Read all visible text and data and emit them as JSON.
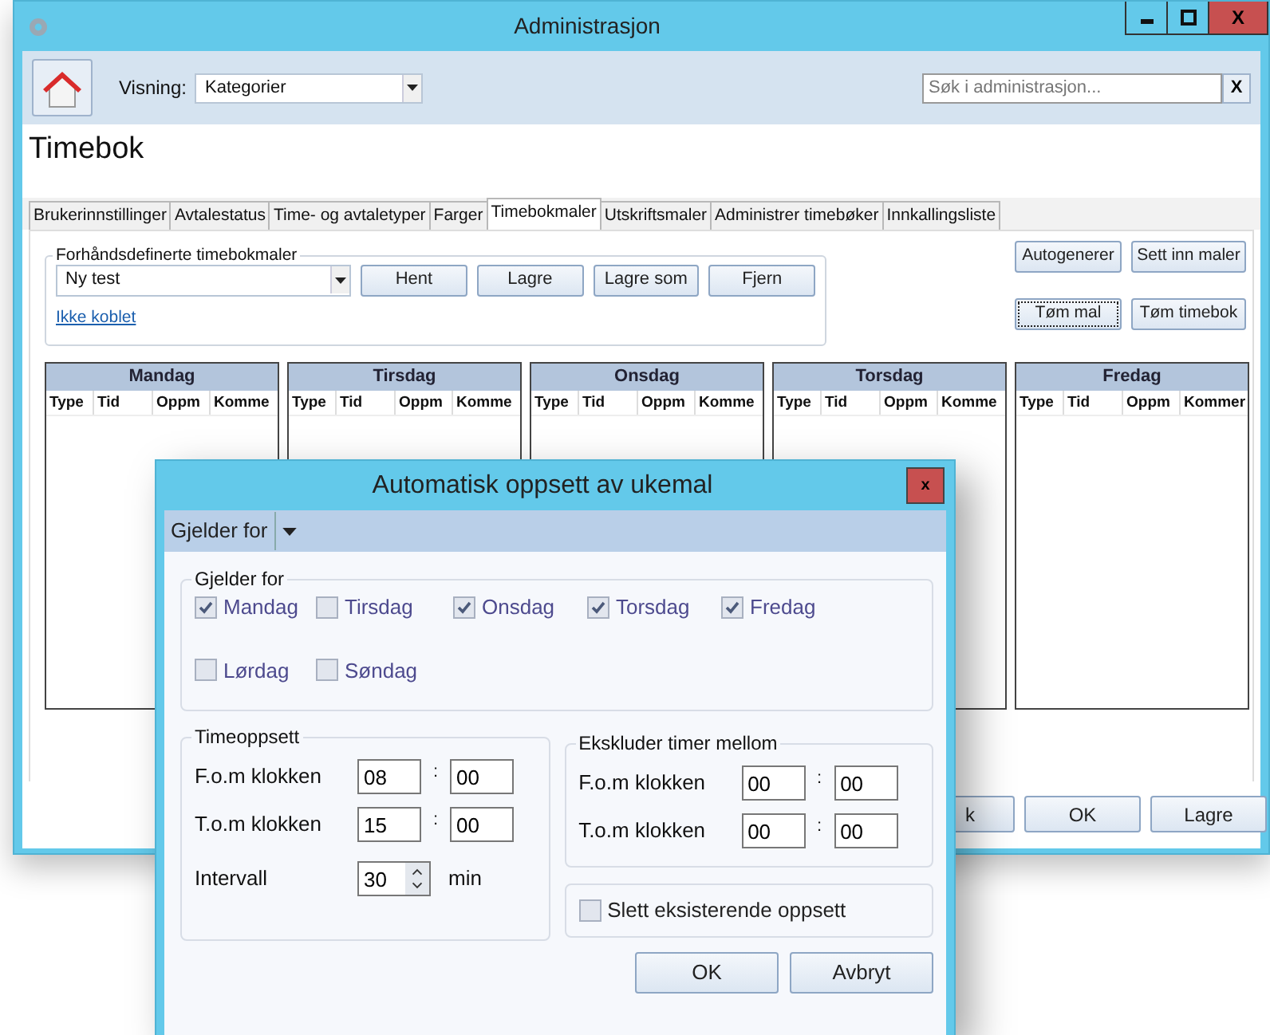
{
  "main_window": {
    "title": "Administrasjon",
    "close_glyph": "X",
    "toolbar": {
      "view_label": "Visning:",
      "view_value": "Kategorier",
      "search_placeholder": "Søk i administrasjon...",
      "search_clear": "X"
    },
    "heading": "Timebok",
    "tabs": [
      {
        "label": "Brukerinnstillinger",
        "selected": false
      },
      {
        "label": "Avtalestatus",
        "selected": false
      },
      {
        "label": "Time- og avtaletyper",
        "selected": false
      },
      {
        "label": "Farger",
        "selected": false
      },
      {
        "label": "Timebokmaler",
        "selected": true
      },
      {
        "label": "Utskriftsmaler",
        "selected": false
      },
      {
        "label": "Administrer timebøker",
        "selected": false
      },
      {
        "label": "Innkallingsliste",
        "selected": false
      }
    ],
    "templates_group": {
      "title": "Forhåndsdefinerte timebokmaler",
      "template_value": "Ny test",
      "buttons": [
        "Hent",
        "Lagre",
        "Lagre som",
        "Fjern"
      ],
      "link": "Ikke koblet"
    },
    "side_buttons": [
      {
        "label": "Autogenerer",
        "focused": false
      },
      {
        "label": "Sett inn maler",
        "focused": false
      },
      {
        "label": "Tøm mal",
        "focused": true
      },
      {
        "label": "Tøm timebok",
        "focused": false
      }
    ],
    "days": [
      {
        "name": "Mandag",
        "columns": [
          "Type",
          "Tid",
          "Oppm",
          "Komme"
        ]
      },
      {
        "name": "Tirsdag",
        "columns": [
          "Type",
          "Tid",
          "Oppm",
          "Komme"
        ]
      },
      {
        "name": "Onsdag",
        "columns": [
          "Type",
          "Tid",
          "Oppm",
          "Komme"
        ]
      },
      {
        "name": "Torsdag",
        "columns": [
          "Type",
          "Tid",
          "Oppm",
          "Komme"
        ]
      },
      {
        "name": "Fredag",
        "columns": [
          "Type",
          "Tid",
          "Oppm",
          "Kommer"
        ]
      }
    ],
    "bottom_buttons": [
      "k",
      "OK",
      "Lagre"
    ]
  },
  "dialog": {
    "title": "Automatisk oppsett av ukemal",
    "close_glyph": "x",
    "toolbar_menu": "Gjelder for",
    "days_group": {
      "title": "Gjelder for",
      "days": [
        {
          "label": "Mandag",
          "checked": true
        },
        {
          "label": "Tirsdag",
          "checked": false
        },
        {
          "label": "Onsdag",
          "checked": true
        },
        {
          "label": "Torsdag",
          "checked": true
        },
        {
          "label": "Fredag",
          "checked": true
        },
        {
          "label": "Lørdag",
          "checked": false
        },
        {
          "label": "Søndag",
          "checked": false
        }
      ]
    },
    "time_group": {
      "title": "Timeoppsett",
      "rows": [
        {
          "label": "F.o.m klokken",
          "hours": "08",
          "separator": ":",
          "minutes": "00"
        },
        {
          "label": "T.o.m klokken",
          "hours": "15",
          "separator": ":",
          "minutes": "00"
        }
      ],
      "interval_label": "Intervall",
      "interval_value": "30",
      "interval_unit": "min"
    },
    "exclude_group": {
      "title": "Ekskluder timer mellom",
      "rows": [
        {
          "label": "F.o.m klokken",
          "hours": "00",
          "separator": ":",
          "minutes": "00"
        },
        {
          "label": "T.o.m klokken",
          "hours": "00",
          "separator": ":",
          "minutes": "00"
        }
      ]
    },
    "delete_existing": {
      "label": "Slett eksisterende oppsett",
      "checked": false
    },
    "buttons": [
      "OK",
      "Avbryt"
    ]
  }
}
